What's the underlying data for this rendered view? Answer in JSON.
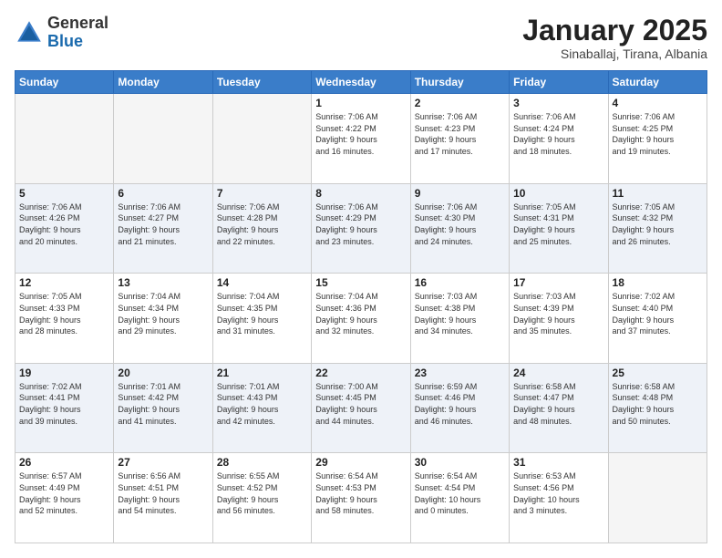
{
  "header": {
    "logo_general": "General",
    "logo_blue": "Blue",
    "month_title": "January 2025",
    "location": "Sinaballaj, Tirana, Albania"
  },
  "weekdays": [
    "Sunday",
    "Monday",
    "Tuesday",
    "Wednesday",
    "Thursday",
    "Friday",
    "Saturday"
  ],
  "weeks": [
    [
      {
        "day": "",
        "info": ""
      },
      {
        "day": "",
        "info": ""
      },
      {
        "day": "",
        "info": ""
      },
      {
        "day": "1",
        "info": "Sunrise: 7:06 AM\nSunset: 4:22 PM\nDaylight: 9 hours\nand 16 minutes."
      },
      {
        "day": "2",
        "info": "Sunrise: 7:06 AM\nSunset: 4:23 PM\nDaylight: 9 hours\nand 17 minutes."
      },
      {
        "day": "3",
        "info": "Sunrise: 7:06 AM\nSunset: 4:24 PM\nDaylight: 9 hours\nand 18 minutes."
      },
      {
        "day": "4",
        "info": "Sunrise: 7:06 AM\nSunset: 4:25 PM\nDaylight: 9 hours\nand 19 minutes."
      }
    ],
    [
      {
        "day": "5",
        "info": "Sunrise: 7:06 AM\nSunset: 4:26 PM\nDaylight: 9 hours\nand 20 minutes."
      },
      {
        "day": "6",
        "info": "Sunrise: 7:06 AM\nSunset: 4:27 PM\nDaylight: 9 hours\nand 21 minutes."
      },
      {
        "day": "7",
        "info": "Sunrise: 7:06 AM\nSunset: 4:28 PM\nDaylight: 9 hours\nand 22 minutes."
      },
      {
        "day": "8",
        "info": "Sunrise: 7:06 AM\nSunset: 4:29 PM\nDaylight: 9 hours\nand 23 minutes."
      },
      {
        "day": "9",
        "info": "Sunrise: 7:06 AM\nSunset: 4:30 PM\nDaylight: 9 hours\nand 24 minutes."
      },
      {
        "day": "10",
        "info": "Sunrise: 7:05 AM\nSunset: 4:31 PM\nDaylight: 9 hours\nand 25 minutes."
      },
      {
        "day": "11",
        "info": "Sunrise: 7:05 AM\nSunset: 4:32 PM\nDaylight: 9 hours\nand 26 minutes."
      }
    ],
    [
      {
        "day": "12",
        "info": "Sunrise: 7:05 AM\nSunset: 4:33 PM\nDaylight: 9 hours\nand 28 minutes."
      },
      {
        "day": "13",
        "info": "Sunrise: 7:04 AM\nSunset: 4:34 PM\nDaylight: 9 hours\nand 29 minutes."
      },
      {
        "day": "14",
        "info": "Sunrise: 7:04 AM\nSunset: 4:35 PM\nDaylight: 9 hours\nand 31 minutes."
      },
      {
        "day": "15",
        "info": "Sunrise: 7:04 AM\nSunset: 4:36 PM\nDaylight: 9 hours\nand 32 minutes."
      },
      {
        "day": "16",
        "info": "Sunrise: 7:03 AM\nSunset: 4:38 PM\nDaylight: 9 hours\nand 34 minutes."
      },
      {
        "day": "17",
        "info": "Sunrise: 7:03 AM\nSunset: 4:39 PM\nDaylight: 9 hours\nand 35 minutes."
      },
      {
        "day": "18",
        "info": "Sunrise: 7:02 AM\nSunset: 4:40 PM\nDaylight: 9 hours\nand 37 minutes."
      }
    ],
    [
      {
        "day": "19",
        "info": "Sunrise: 7:02 AM\nSunset: 4:41 PM\nDaylight: 9 hours\nand 39 minutes."
      },
      {
        "day": "20",
        "info": "Sunrise: 7:01 AM\nSunset: 4:42 PM\nDaylight: 9 hours\nand 41 minutes."
      },
      {
        "day": "21",
        "info": "Sunrise: 7:01 AM\nSunset: 4:43 PM\nDaylight: 9 hours\nand 42 minutes."
      },
      {
        "day": "22",
        "info": "Sunrise: 7:00 AM\nSunset: 4:45 PM\nDaylight: 9 hours\nand 44 minutes."
      },
      {
        "day": "23",
        "info": "Sunrise: 6:59 AM\nSunset: 4:46 PM\nDaylight: 9 hours\nand 46 minutes."
      },
      {
        "day": "24",
        "info": "Sunrise: 6:58 AM\nSunset: 4:47 PM\nDaylight: 9 hours\nand 48 minutes."
      },
      {
        "day": "25",
        "info": "Sunrise: 6:58 AM\nSunset: 4:48 PM\nDaylight: 9 hours\nand 50 minutes."
      }
    ],
    [
      {
        "day": "26",
        "info": "Sunrise: 6:57 AM\nSunset: 4:49 PM\nDaylight: 9 hours\nand 52 minutes."
      },
      {
        "day": "27",
        "info": "Sunrise: 6:56 AM\nSunset: 4:51 PM\nDaylight: 9 hours\nand 54 minutes."
      },
      {
        "day": "28",
        "info": "Sunrise: 6:55 AM\nSunset: 4:52 PM\nDaylight: 9 hours\nand 56 minutes."
      },
      {
        "day": "29",
        "info": "Sunrise: 6:54 AM\nSunset: 4:53 PM\nDaylight: 9 hours\nand 58 minutes."
      },
      {
        "day": "30",
        "info": "Sunrise: 6:54 AM\nSunset: 4:54 PM\nDaylight: 10 hours\nand 0 minutes."
      },
      {
        "day": "31",
        "info": "Sunrise: 6:53 AM\nSunset: 4:56 PM\nDaylight: 10 hours\nand 3 minutes."
      },
      {
        "day": "",
        "info": ""
      }
    ]
  ]
}
